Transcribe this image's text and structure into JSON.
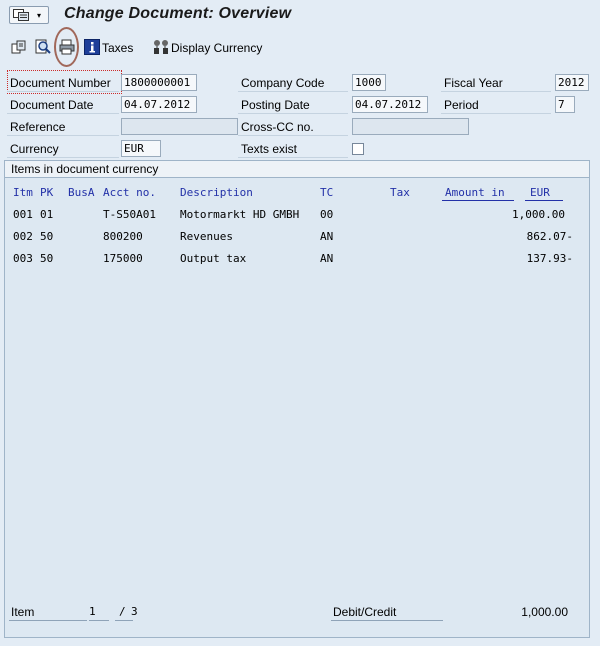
{
  "window": {
    "title": "Change Document: Overview"
  },
  "toolbar": {
    "taxes_label": "Taxes",
    "display_currency_label": "Display Currency"
  },
  "header": {
    "document_number_label": "Document Number",
    "document_number": "1800000001",
    "company_code_label": "Company Code",
    "company_code": "1000",
    "fiscal_year_label": "Fiscal Year",
    "fiscal_year": "2012",
    "document_date_label": "Document Date",
    "document_date": "04.07.2012",
    "posting_date_label": "Posting Date",
    "posting_date": "04.07.2012",
    "period_label": "Period",
    "period": "7",
    "reference_label": "Reference",
    "reference": "",
    "cross_cc_label": "Cross-CC no.",
    "cross_cc": "",
    "currency_label": "Currency",
    "currency": "EUR",
    "texts_exist_label": "Texts exist"
  },
  "items": {
    "panel_title": "Items in document currency",
    "columns": {
      "itm": "Itm",
      "pk": "PK",
      "busa": "BusA",
      "acct": "Acct no.",
      "desc": "Description",
      "tc": "TC",
      "tax": "Tax",
      "amount": "Amount in",
      "currency": "EUR"
    },
    "rows": [
      {
        "itm": "001",
        "pk": "01",
        "busa": "",
        "acct": "T-S50A01",
        "desc": "Motormarkt HD GMBH",
        "tc": "00",
        "amount": "1,000.00"
      },
      {
        "itm": "002",
        "pk": "50",
        "busa": "",
        "acct": "800200",
        "desc": "Revenues",
        "tc": "AN",
        "amount": "862.07-"
      },
      {
        "itm": "003",
        "pk": "50",
        "busa": "",
        "acct": "175000",
        "desc": "Output tax",
        "tc": "AN",
        "amount": "137.93-"
      }
    ]
  },
  "footer": {
    "item_label": "Item",
    "item_current": "1",
    "item_sep": "/",
    "item_total": "3",
    "debit_credit_label": "Debit/Credit",
    "debit_credit_value": "1,000.00"
  }
}
